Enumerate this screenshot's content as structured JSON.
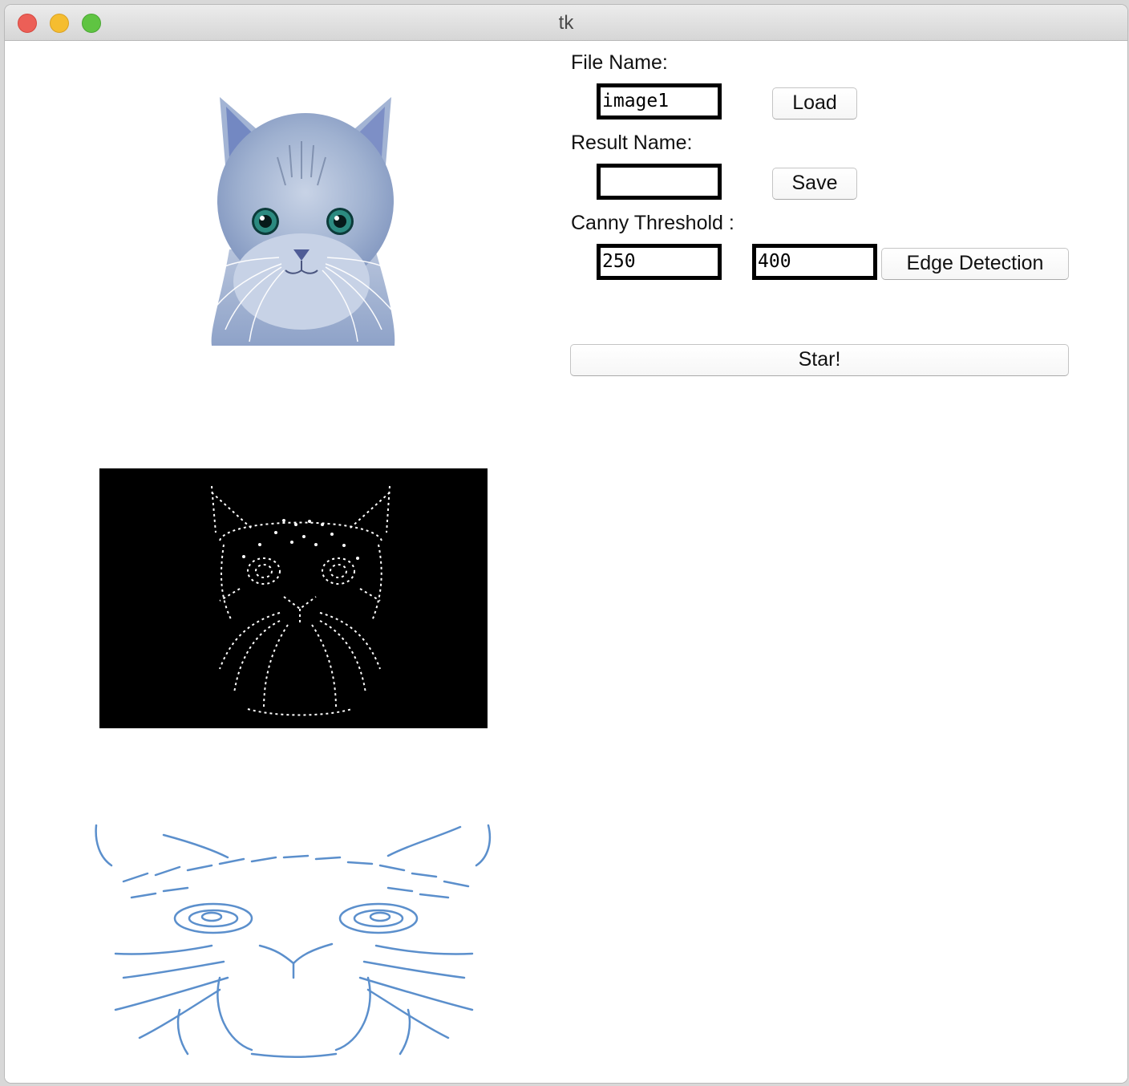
{
  "window": {
    "title": "tk"
  },
  "form": {
    "file_name_label": "File Name:",
    "file_name_value": "image1",
    "load_label": "Load",
    "result_name_label": "Result Name:",
    "result_name_value": "",
    "save_label": "Save",
    "canny_label": "Canny Threshold :",
    "threshold_low": "250",
    "threshold_high": "400",
    "edge_detection_label": "Edge Detection",
    "start_label": "Star!"
  },
  "colors": {
    "edge_result_stroke": "#5b8fcc",
    "canny_background": "#000000",
    "canny_edges": "#ffffff"
  }
}
